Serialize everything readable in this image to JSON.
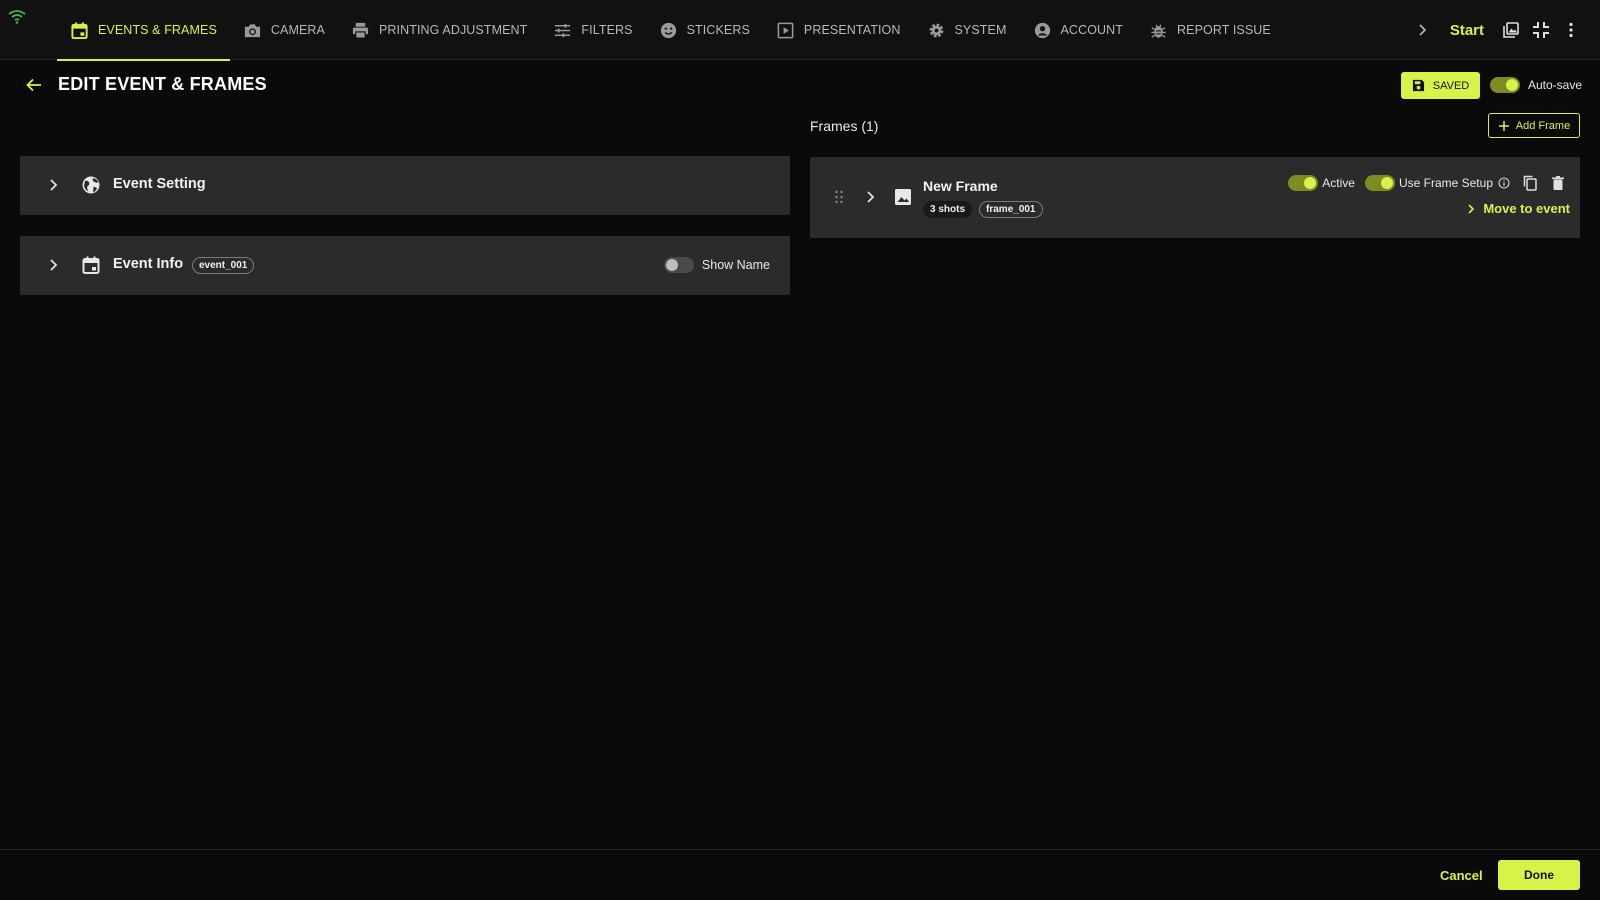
{
  "nav": {
    "tabs": [
      {
        "label": "EVENTS & FRAMES",
        "icon": "calendar-icon",
        "active": true
      },
      {
        "label": "CAMERA",
        "icon": "camera-icon"
      },
      {
        "label": "PRINTING ADJUSTMENT",
        "icon": "printer-icon"
      },
      {
        "label": "FILTERS",
        "icon": "sliders-icon"
      },
      {
        "label": "STICKERS",
        "icon": "smiley-icon"
      },
      {
        "label": "PRESENTATION",
        "icon": "play-icon"
      },
      {
        "label": "SYSTEM",
        "icon": "gear-icon"
      },
      {
        "label": "ACCOUNT",
        "icon": "account-icon"
      },
      {
        "label": "REPORT ISSUE",
        "icon": "bug-icon"
      }
    ],
    "start_label": "Start"
  },
  "header": {
    "title": "EDIT EVENT & FRAMES",
    "saved_label": "SAVED",
    "autosave_label": "Auto-save",
    "autosave_on": true
  },
  "panels": {
    "event_setting": {
      "label": "Event Setting"
    },
    "event_info": {
      "label": "Event Info",
      "chip": "event_001",
      "show_name_label": "Show Name",
      "show_name_on": false
    }
  },
  "frames": {
    "title": "Frames (1)",
    "add_label": "Add Frame",
    "items": [
      {
        "title": "New Frame",
        "shots": "3 shots",
        "id": "frame_001",
        "active_label": "Active",
        "active_on": true,
        "use_setup_label": "Use Frame Setup",
        "use_setup_on": true,
        "move_label": "Move to event"
      }
    ]
  },
  "footer": {
    "cancel_label": "Cancel",
    "done_label": "Done"
  },
  "colors": {
    "accent": "#d9f24a",
    "background": "#0a0a0a",
    "panel": "#2b2b2b",
    "nav": "#111111"
  }
}
